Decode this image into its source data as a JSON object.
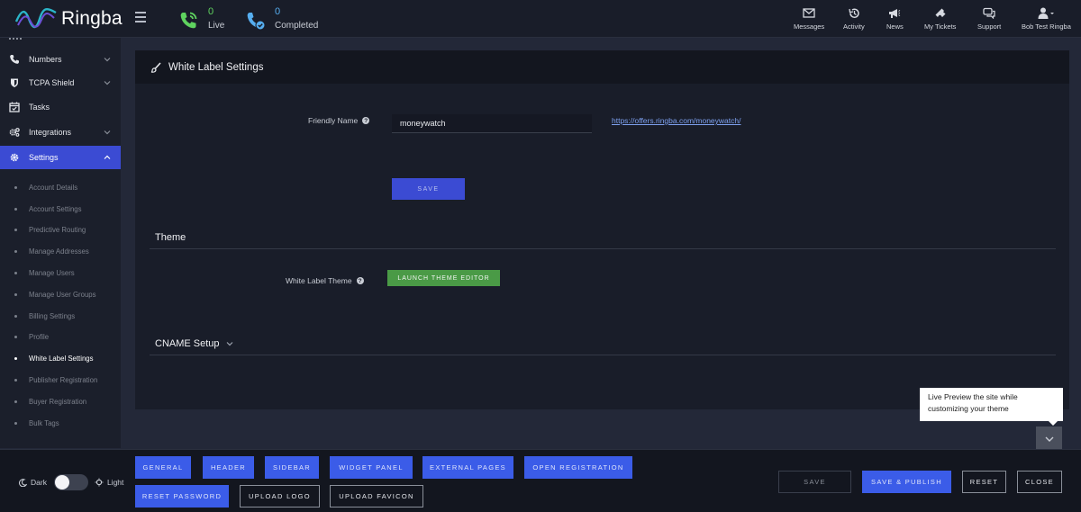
{
  "app": {
    "brand": "Ringba",
    "colors": {
      "accent": "#3b4bd3",
      "live": "#5fd35f",
      "completed": "#56aef0",
      "theme_button": "#4a9a46"
    }
  },
  "topbar": {
    "stats": [
      {
        "value": "0",
        "label": "Live",
        "icon": "phone-live-icon"
      },
      {
        "value": "0",
        "label": "Completed",
        "icon": "phone-completed-icon"
      }
    ],
    "nav": [
      {
        "label": "Messages",
        "icon": "envelope-icon"
      },
      {
        "label": "Activity",
        "icon": "history-icon"
      },
      {
        "label": "News",
        "icon": "megaphone-icon"
      },
      {
        "label": "My Tickets",
        "icon": "ticket-icon"
      },
      {
        "label": "Support",
        "icon": "chat-icon"
      },
      {
        "label": "Bob Test Ringba",
        "icon": "user-icon"
      }
    ]
  },
  "sidebar": {
    "items": [
      {
        "label": "Numbers",
        "icon": "phone-icon",
        "expandable": true
      },
      {
        "label": "TCPA Shield",
        "icon": "shield-icon",
        "expandable": true
      },
      {
        "label": "Tasks",
        "icon": "calendar-check-icon",
        "expandable": false
      },
      {
        "label": "Integrations",
        "icon": "cogs-icon",
        "expandable": true
      },
      {
        "label": "Settings",
        "icon": "gear-icon",
        "expandable": true,
        "active": true
      }
    ],
    "subitems": [
      "Account Details",
      "Account Settings",
      "Predictive Routing",
      "Manage Addresses",
      "Manage Users",
      "Manage User Groups",
      "Billing Settings",
      "Profile",
      "White Label Settings",
      "Publisher Registration",
      "Buyer Registration",
      "Bulk Tags"
    ],
    "current_subitem": "White Label Settings"
  },
  "main": {
    "title": "White Label Settings",
    "friendly_name_label": "Friendly Name",
    "friendly_name_value": "moneywatch",
    "url": "https://offers.ringba.com/moneywatch/",
    "save_label": "SAVE",
    "theme_section": "Theme",
    "white_label_theme_label": "White Label Theme",
    "launch_theme_editor": "LAUNCH THEME EDITOR",
    "cname_section": "CNAME Setup"
  },
  "tooltip": {
    "line1": "Live Preview the site while",
    "line2": "customizing your theme"
  },
  "bottombar": {
    "dark_label": "Dark",
    "light_label": "Light",
    "tabs": [
      "GENERAL",
      "HEADER",
      "SIDEBAR",
      "WIDGET PANEL",
      "EXTERNAL PAGES",
      "OPEN REGISTRATION",
      "RESET PASSWORD"
    ],
    "upload_logo": "UPLOAD LOGO",
    "upload_favicon": "UPLOAD FAVICON",
    "save": "SAVE",
    "save_publish": "SAVE & PUBLISH",
    "reset": "RESET",
    "close": "CLOSE"
  }
}
